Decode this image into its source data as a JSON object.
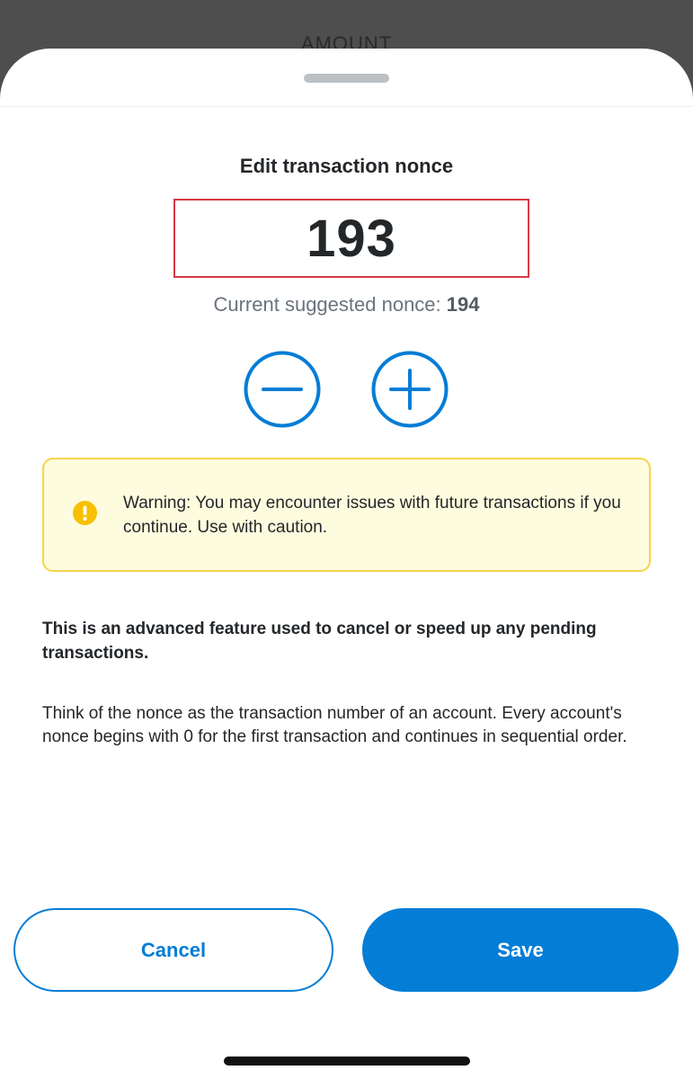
{
  "background": {
    "label": "AMOUNT"
  },
  "modal": {
    "title": "Edit transaction nonce",
    "nonce_value": "193",
    "suggested_label": "Current suggested nonce:",
    "suggested_value": "194",
    "decrement_icon": "minus-circle-icon",
    "increment_icon": "plus-circle-icon",
    "warning": {
      "icon": "exclamation-circle-icon",
      "text": "Warning: You may encounter issues with future transactions if you continue. Use with caution."
    },
    "advanced_text": "This is an advanced feature used to cancel or speed up any pending transactions.",
    "explanation_text": "Think of the nonce as the transaction number of an account. Every account's nonce begins with 0 for the first transaction and continues in sequential order.",
    "cancel_label": "Cancel",
    "save_label": "Save"
  },
  "colors": {
    "primary": "#037dd6",
    "warning_bg": "#fefcde",
    "warning_border": "#f8d34c",
    "warning_icon": "#f8c000",
    "highlight_border": "#d73a49",
    "text": "#24272a",
    "muted_text": "#6a737d"
  }
}
